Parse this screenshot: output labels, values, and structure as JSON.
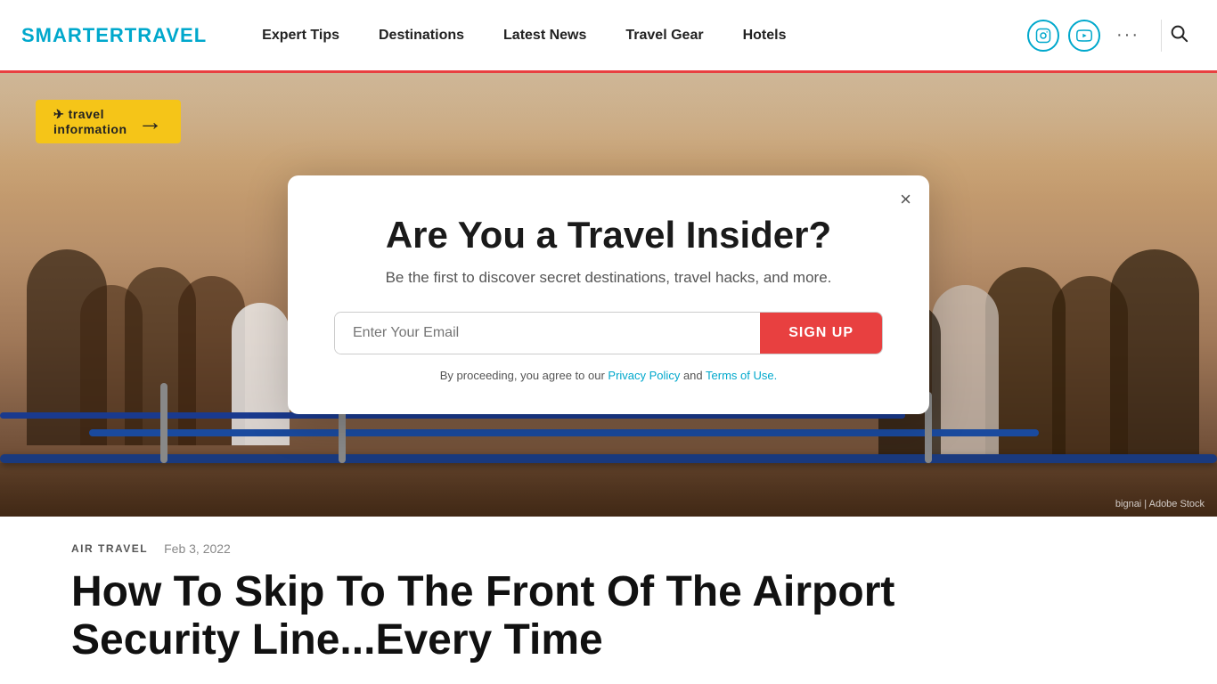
{
  "site": {
    "brand_text": "SMARTER",
    "brand_text_accent": "TRAVEL"
  },
  "nav": {
    "items": [
      {
        "label": "Expert Tips",
        "id": "expert-tips"
      },
      {
        "label": "Destinations",
        "id": "destinations"
      },
      {
        "label": "Latest News",
        "id": "latest-news"
      },
      {
        "label": "Travel Gear",
        "id": "travel-gear"
      },
      {
        "label": "Hotels",
        "id": "hotels"
      }
    ]
  },
  "header": {
    "instagram_icon": "📷",
    "youtube_icon": "▶",
    "more_icon": "•••",
    "search_icon": "🔍"
  },
  "modal": {
    "title": "Are You a Travel Insider?",
    "subtitle": "Be the first to discover secret destinations, travel hacks, and more.",
    "email_placeholder": "Enter Your Email",
    "signup_label": "SIGN UP",
    "footer_text": "By proceeding, you agree to our",
    "privacy_label": "Privacy Policy",
    "and_text": "and",
    "terms_label": "Terms of Use.",
    "close_label": "×"
  },
  "hero": {
    "sign_text": "⬜⬜⬜",
    "arrow": "→",
    "credit": "bignai | Adobe Stock"
  },
  "article": {
    "category": "AIR TRAVEL",
    "date": "Feb 3, 2022",
    "title_line1": "How To Skip To The Front Of The Airport",
    "title_line2": "Security Line...Every Time"
  }
}
